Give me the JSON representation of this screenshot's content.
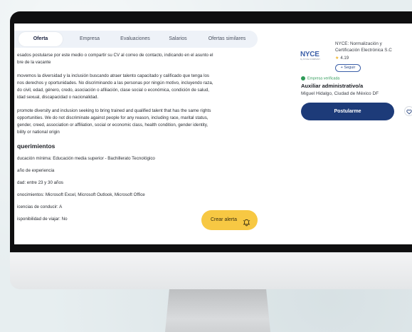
{
  "tabs": [
    {
      "label": "Oferta",
      "active": true
    },
    {
      "label": "Empresa",
      "active": false
    },
    {
      "label": "Evaluaciones",
      "active": false
    },
    {
      "label": "Salarios",
      "active": false
    },
    {
      "label": "Ofertas similares",
      "active": false
    }
  ],
  "description": {
    "paragraphs": [
      [
        "esados postularse por este medio o compartir su CV al correo de contacto, indicando en el asunto el",
        "bre de la vacante"
      ],
      [
        "movemos la diversidad y la inclusión buscando atraer talento capacitado y calificado que tenga los",
        "nos derechos y oportunidades. No discriminando a las personas por ningún motivo, incluyendo raza,",
        "do civil, edad, género, credo, asociación o afiliación, clase social o económica, condición de salud,",
        "idad sexual, discapacidad o nacionalidad."
      ],
      [
        "promote diversity and inclusion seeking to bring trained and qualified talent that has the same rights",
        "opportunities. We do not discriminate against people for any reason, including race, marital status,",
        "gender, creed, association or affiliation, social or economic class, health condition, gender identity,",
        "bility or national origin"
      ]
    ]
  },
  "requirements": {
    "title": "querimientos",
    "items": [
      "ducación mínima: Educación media superior - Bachillerato Tecnológico",
      "año de experiencia",
      "dad: entre 23 y 30 años",
      "onocimientos: Microsoft Excel, Microsoft Outlook, Microsoft Office",
      "icencias de conducir: A",
      "isponibilidad de viajar: No"
    ]
  },
  "alert_button": {
    "label": "Crear alerta",
    "icon": "bell-icon"
  },
  "company_card": {
    "logo_text": "NYCE",
    "logo_subtext": "by NYCE COMPANY",
    "name_line1": "NYCE: Normalización y",
    "name_line2": "Certificación Electrónica S.C",
    "rating": "4.19",
    "follow_label": "+ Seguir",
    "verified_label": "Empresa verificada",
    "job_title": "Auxiliar administrativo/a",
    "location": "Miguel Hidalgo, Ciudad de México DF",
    "apply_label": "Postularme",
    "colors": {
      "primary": "#1d3b79",
      "accent": "#f7c843",
      "verified": "#2f9a58"
    }
  }
}
